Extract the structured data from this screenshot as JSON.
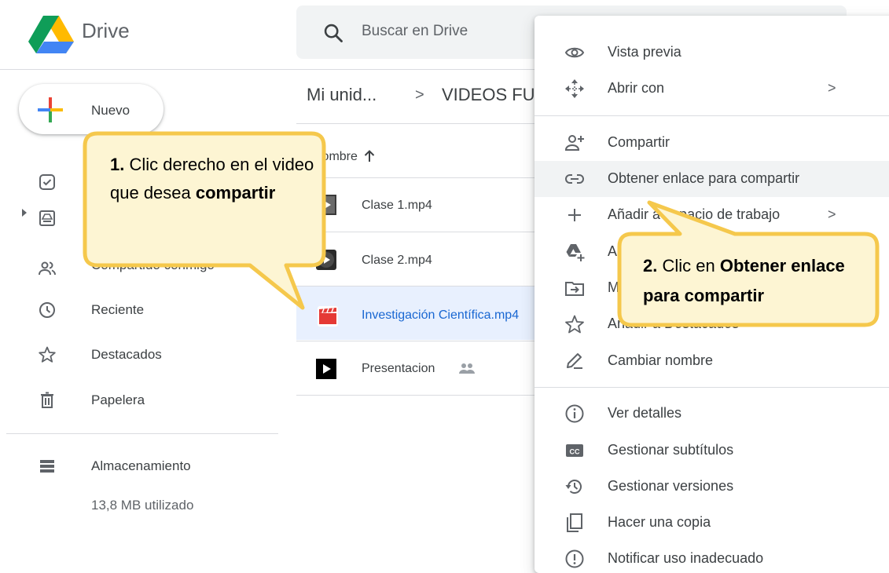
{
  "header": {
    "brand": "Drive",
    "search_placeholder": "Buscar en Drive",
    "logo_icon": "google-drive-logo",
    "search_icon": "search-icon"
  },
  "sidebar": {
    "new_label": "Nuevo",
    "items": [
      {
        "label": "",
        "icon": "check-circle-icon"
      },
      {
        "label": "",
        "icon": "my-drive-icon"
      },
      {
        "label": "Compartido conmigo",
        "icon": "people-icon"
      },
      {
        "label": "Reciente",
        "icon": "clock-icon"
      },
      {
        "label": "Destacados",
        "icon": "star-icon"
      },
      {
        "label": "Papelera",
        "icon": "trash-icon"
      }
    ],
    "storage_label": "Almacenamiento",
    "storage_used": "13,8 MB utilizado"
  },
  "breadcrumb": {
    "root": "Mi unid...",
    "separator": ">",
    "current": "VIDEOS FU"
  },
  "list": {
    "column_name": "Nombre",
    "files": [
      {
        "name": "Clase 1.mp4",
        "icon": "video-file-icon"
      },
      {
        "name": "Clase 2.mp4",
        "icon": "video-file-icon"
      },
      {
        "name": "Investigación Científica.mp4",
        "icon": "video-clapper-icon",
        "selected": true
      },
      {
        "name": "Presentacion",
        "icon": "video-file-icon",
        "shared": true
      }
    ]
  },
  "context_menu": {
    "items": [
      {
        "label": "Vista previa",
        "icon": "eye-icon"
      },
      {
        "label": "Abrir con",
        "icon": "move-arrows-icon",
        "submenu": true
      },
      {
        "label": "Compartir",
        "icon": "person-add-icon"
      },
      {
        "label": "Obtener enlace para compartir",
        "icon": "link-icon",
        "highlighted": true
      },
      {
        "label": "Añadir a espacio de trabajo",
        "icon": "plus-icon",
        "submenu": true
      },
      {
        "label": "Añadir acceso directo a Drive",
        "icon": "drive-add-icon"
      },
      {
        "label": "Mover a",
        "icon": "folder-move-icon"
      },
      {
        "label": "Añadir a Destacados",
        "icon": "star-icon"
      },
      {
        "label": "Cambiar nombre",
        "icon": "pencil-icon"
      },
      {
        "label": "Ver detalles",
        "icon": "info-icon"
      },
      {
        "label": "Gestionar subtítulos",
        "icon": "cc-icon"
      },
      {
        "label": "Gestionar versiones",
        "icon": "history-icon"
      },
      {
        "label": "Hacer una copia",
        "icon": "copy-icon"
      },
      {
        "label": "Notificar uso inadecuado",
        "icon": "report-icon"
      }
    ],
    "submenu_chevron": ">"
  },
  "callouts": {
    "step1": {
      "number": "1.",
      "text_a": " Clic derecho en el video que desea ",
      "bold": "compartir"
    },
    "step2": {
      "number": "2.",
      "text_a": " Clic en ",
      "bold": "Obtener enlace para compartir"
    }
  },
  "colors": {
    "callout_fill": "#fdf5d3",
    "callout_border": "#f5c84c",
    "selected_row": "#e8f0fe",
    "selected_text": "#1967d2"
  }
}
